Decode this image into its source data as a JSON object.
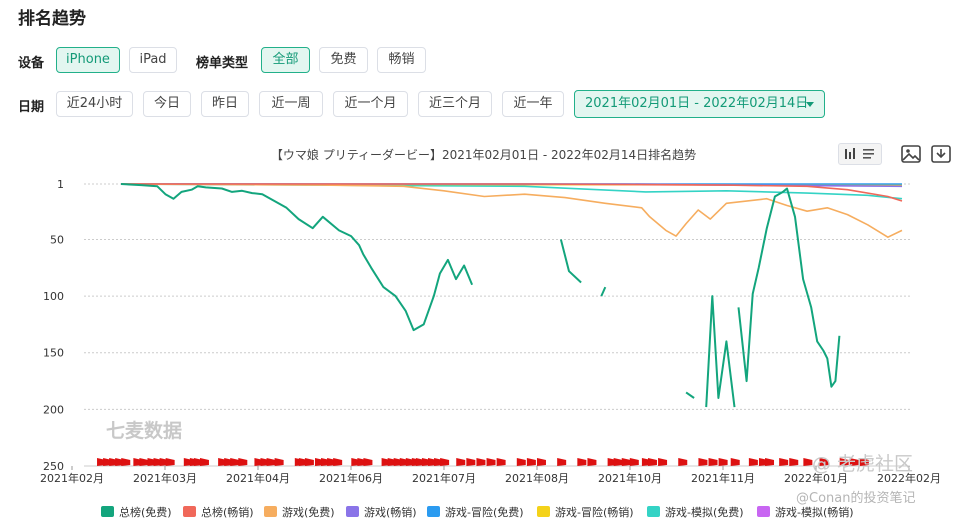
{
  "page": {
    "title": "排名趋势"
  },
  "filters": {
    "device_label": "设备",
    "devices": [
      {
        "label": "iPhone",
        "active": true
      },
      {
        "label": "iPad",
        "active": false
      }
    ],
    "list_type_label": "榜单类型",
    "list_types": [
      {
        "label": "全部",
        "active": true
      },
      {
        "label": "免费",
        "active": false
      },
      {
        "label": "畅销",
        "active": false
      }
    ],
    "date_label": "日期",
    "dates": [
      {
        "label": "近24小时"
      },
      {
        "label": "今日"
      },
      {
        "label": "昨日"
      },
      {
        "label": "近一周"
      },
      {
        "label": "近一个月"
      },
      {
        "label": "近三个月"
      },
      {
        "label": "近一年"
      }
    ],
    "date_range": "2021年02月01日 - 2022年02月14日"
  },
  "toolbar": {
    "icons": [
      "bar-chart-icon",
      "list-icon",
      "image-icon",
      "download-icon"
    ]
  },
  "watermarks": {
    "chart": "七麦数据",
    "community": "@ 老虎社区",
    "author": "@Conan的投资笔记"
  },
  "colors": {
    "accent": "#22b08a",
    "grid": "#cccccc",
    "marker": "#dd1111"
  },
  "chart_data": {
    "type": "line",
    "title": "【ウマ娘 プリティーダービー】2021年02月01日 - 2022年02月14日排名趋势",
    "y_reversed": true,
    "ylim": [
      1,
      250
    ],
    "y_ticks": [
      "1",
      "50",
      "100",
      "150",
      "200",
      "250"
    ],
    "x_ticks": [
      "2021年02月",
      "2021年03月",
      "2021年04月",
      "2021年06月",
      "2021年07月",
      "2021年08月",
      "2021年10月",
      "2021年11月",
      "2022年01月",
      "2022年02月"
    ],
    "grid": true,
    "legend_position": "bottom",
    "series": [
      {
        "name": "总榜(免费)",
        "color": "#13a57d",
        "points": [
          [
            0,
            1
          ],
          [
            10,
            2
          ],
          [
            18,
            3
          ],
          [
            22,
            10
          ],
          [
            26,
            14
          ],
          [
            30,
            8
          ],
          [
            35,
            6
          ],
          [
            38,
            3
          ],
          [
            42,
            4
          ],
          [
            50,
            5
          ],
          [
            55,
            8
          ],
          [
            60,
            7
          ],
          [
            65,
            9
          ],
          [
            70,
            10
          ],
          [
            75,
            15
          ],
          [
            82,
            22
          ],
          [
            88,
            32
          ],
          [
            95,
            40
          ],
          [
            100,
            30
          ],
          [
            108,
            42
          ],
          [
            114,
            47
          ],
          [
            118,
            55
          ],
          [
            120,
            63
          ],
          [
            124,
            75
          ],
          [
            130,
            92
          ],
          [
            136,
            100
          ],
          [
            141,
            113
          ],
          [
            145,
            130
          ],
          [
            150,
            125
          ],
          [
            155,
            100
          ],
          [
            158,
            80
          ],
          [
            162,
            68
          ],
          [
            166,
            85
          ],
          [
            170,
            73
          ],
          [
            174,
            90
          ],
          null,
          [
            218,
            50
          ],
          [
            222,
            78
          ],
          [
            228,
            88
          ],
          null,
          [
            238,
            100
          ],
          [
            240,
            92
          ],
          null,
          [
            252,
            72
          ],
          null,
          [
            280,
            185
          ],
          [
            284,
            190
          ],
          null,
          [
            290,
            198
          ],
          [
            293,
            100
          ],
          [
            296,
            190
          ],
          [
            300,
            140
          ],
          [
            304,
            198
          ],
          null,
          [
            306,
            110
          ],
          [
            310,
            175
          ],
          [
            313,
            98
          ],
          [
            316,
            75
          ],
          [
            320,
            40
          ],
          [
            324,
            12
          ],
          [
            328,
            8
          ],
          [
            330,
            5
          ],
          [
            334,
            30
          ],
          [
            338,
            85
          ],
          [
            342,
            110
          ],
          [
            345,
            140
          ],
          [
            348,
            148
          ],
          [
            350,
            155
          ],
          [
            352,
            180
          ],
          [
            354,
            175
          ],
          [
            356,
            135
          ],
          null,
          [
            366,
            195
          ]
        ]
      },
      {
        "name": "总榜(畅销)",
        "color": "#f0685a",
        "points": [
          [
            0,
            1
          ],
          [
            100,
            1
          ],
          [
            200,
            1
          ],
          [
            300,
            2
          ],
          [
            340,
            3
          ],
          [
            360,
            6
          ],
          [
            380,
            12
          ],
          [
            387,
            16
          ]
        ]
      },
      {
        "name": "游戏(免费)",
        "color": "#f6ad5f",
        "points": [
          [
            0,
            1
          ],
          [
            100,
            2
          ],
          [
            140,
            3
          ],
          [
            160,
            7
          ],
          [
            180,
            12
          ],
          [
            200,
            10
          ],
          [
            220,
            13
          ],
          [
            240,
            18
          ],
          [
            258,
            22
          ],
          [
            262,
            30
          ],
          [
            270,
            42
          ],
          [
            275,
            47
          ],
          [
            280,
            36
          ],
          [
            286,
            24
          ],
          [
            292,
            32
          ],
          [
            300,
            18
          ],
          [
            320,
            14
          ],
          [
            330,
            20
          ],
          [
            340,
            25
          ],
          [
            350,
            22
          ],
          [
            360,
            28
          ],
          [
            370,
            37
          ],
          [
            380,
            48
          ],
          [
            387,
            42
          ]
        ]
      },
      {
        "name": "游戏(畅销)",
        "color": "#8a74e8",
        "points": [
          [
            0,
            1
          ],
          [
            150,
            1
          ],
          [
            250,
            1
          ],
          [
            300,
            2
          ],
          [
            387,
            3
          ]
        ]
      },
      {
        "name": "游戏-冒险(免费)",
        "color": "#2b9bf0",
        "points": [
          [
            0,
            1
          ],
          [
            387,
            1
          ]
        ]
      },
      {
        "name": "游戏-冒险(畅销)",
        "color": "#f4d21a",
        "points": [
          [
            0,
            1
          ],
          [
            387,
            2
          ]
        ]
      },
      {
        "name": "游戏-模拟(免费)",
        "color": "#34d3c5",
        "points": [
          [
            0,
            1
          ],
          [
            200,
            3
          ],
          [
            260,
            8
          ],
          [
            300,
            7
          ],
          [
            340,
            9
          ],
          [
            370,
            11
          ],
          [
            387,
            14
          ]
        ]
      },
      {
        "name": "游戏-模拟(畅销)",
        "color": "#c866f2",
        "points": [
          [
            0,
            1
          ],
          [
            387,
            2
          ]
        ]
      }
    ],
    "marker_days": [
      2,
      5,
      8,
      11,
      14,
      20,
      23,
      27,
      30,
      33,
      36,
      45,
      48,
      50,
      53,
      62,
      65,
      68,
      72,
      80,
      83,
      86,
      90,
      100,
      102,
      105,
      110,
      113,
      116,
      119,
      128,
      131,
      134,
      143,
      146,
      149,
      152,
      155,
      158,
      160,
      163,
      166,
      169,
      172,
      180,
      185,
      190,
      195,
      200,
      210,
      215,
      220,
      230,
      240,
      245,
      255,
      258,
      262,
      266,
      272,
      275,
      280,
      290,
      300,
      305,
      310,
      316,
      325,
      330,
      333,
      340,
      345,
      352,
      360,
      370,
      375,
      380
    ]
  }
}
